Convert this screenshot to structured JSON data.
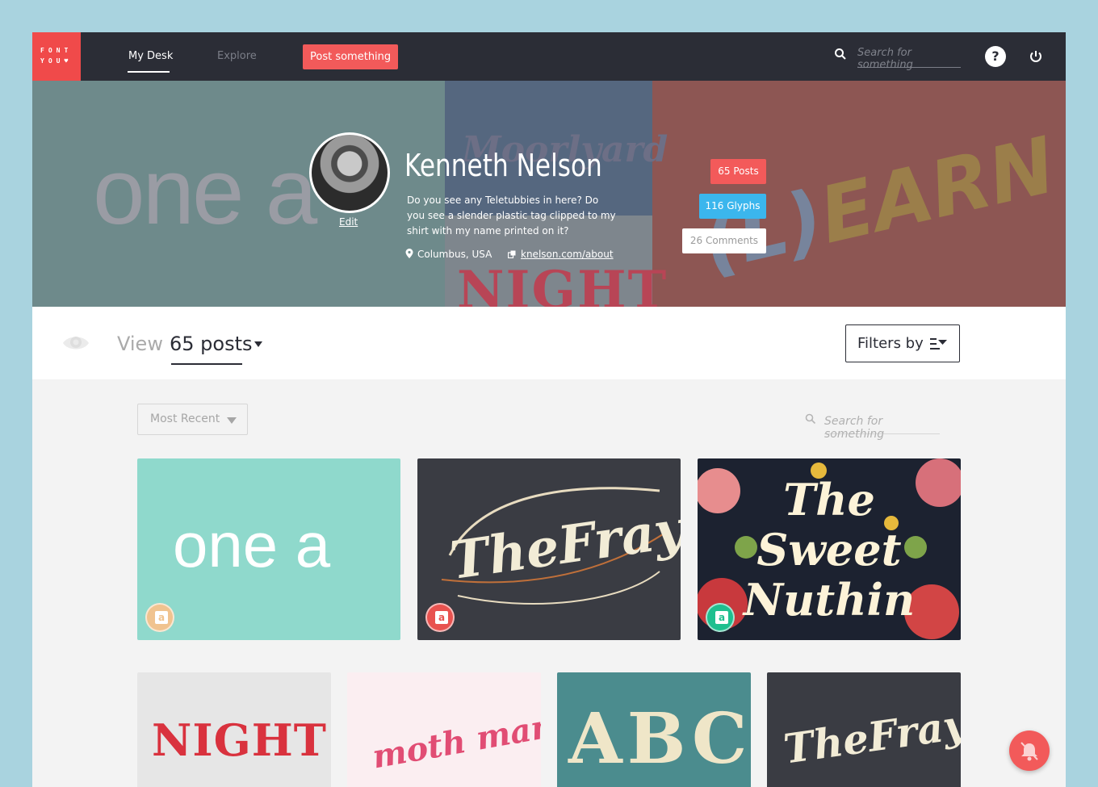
{
  "nav": {
    "logo_line1": "FONT",
    "logo_line2": "YOU♥",
    "my_desk": "My Desk",
    "explore": "Explore",
    "post_button": "Post something",
    "search_placeholder": "Search for something",
    "help": "?"
  },
  "hero": {
    "bg_text_1": "one a",
    "bg_text_2": "Moorlyard",
    "bg_text_3": "NIGHT",
    "bg_text_4_paren": "(L)",
    "bg_text_4": "EARN"
  },
  "profile": {
    "edit": "Edit",
    "name": "Kenneth Nelson",
    "bio": "Do you see any Teletubbies in here? Do you see a slender plastic tag clipped to my shirt with my name printed on it?",
    "location": "Columbus, USA",
    "website": "knelson.com/about",
    "stats": {
      "posts": "65 Posts",
      "glyphs": "116 Glyphs",
      "comments": "26 Comments"
    }
  },
  "view_bar": {
    "label": "View",
    "value": "65 posts",
    "filters": "Filters by"
  },
  "list": {
    "sort": "Most Recent",
    "search_placeholder": "Search for something"
  },
  "cards": [
    {
      "title": "one a",
      "badge": "a",
      "badge_color": "#f0c38f"
    },
    {
      "title": "TheFray",
      "badge": "a",
      "badge_color": "#e8524f"
    },
    {
      "title": "The Sweet Nuthin",
      "badge": "a",
      "badge_color": "#1fbf8f"
    },
    {
      "title": "NIGHT"
    },
    {
      "title": "moth man"
    },
    {
      "title": "ABC"
    },
    {
      "title": "TheFray"
    }
  ],
  "colors": {
    "accent": "#f25a5a",
    "nav_bg": "#2b2d36",
    "glyphs": "#3bb6ed"
  }
}
